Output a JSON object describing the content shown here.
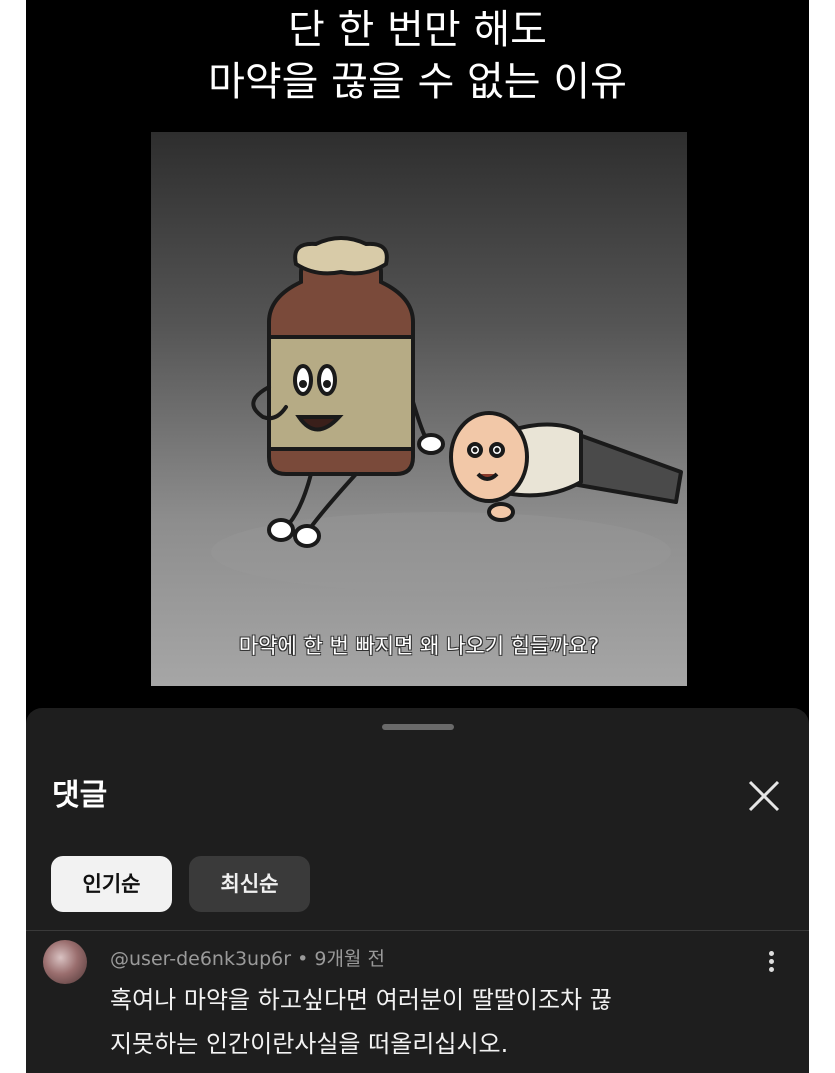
{
  "video": {
    "title_line1": "단 한 번만 해도",
    "title_line2": "마약을 끊을 수 없는 이유",
    "caption": "마약에 한 번 빠지면 왜 나오기 힘들까요?"
  },
  "comments_sheet": {
    "title": "댓글",
    "close_icon": "close-icon",
    "sort_tabs": [
      {
        "label": "인기순",
        "active": true
      },
      {
        "label": "최신순",
        "active": false
      }
    ],
    "comment": {
      "username": "@user-de6nk3up6r",
      "time": "9개월 전",
      "text_line1": "혹여나 마약을 하고싶다면 여러분이 딸딸이조차 끊",
      "text_line2": "지못하는 인간이란사실을 떠올리십시오."
    }
  },
  "colors": {
    "background": "#000000",
    "sheet": "#1e1e1e",
    "chip_active": "#f2f2f2",
    "chip_inactive": "#3a3a3a"
  }
}
